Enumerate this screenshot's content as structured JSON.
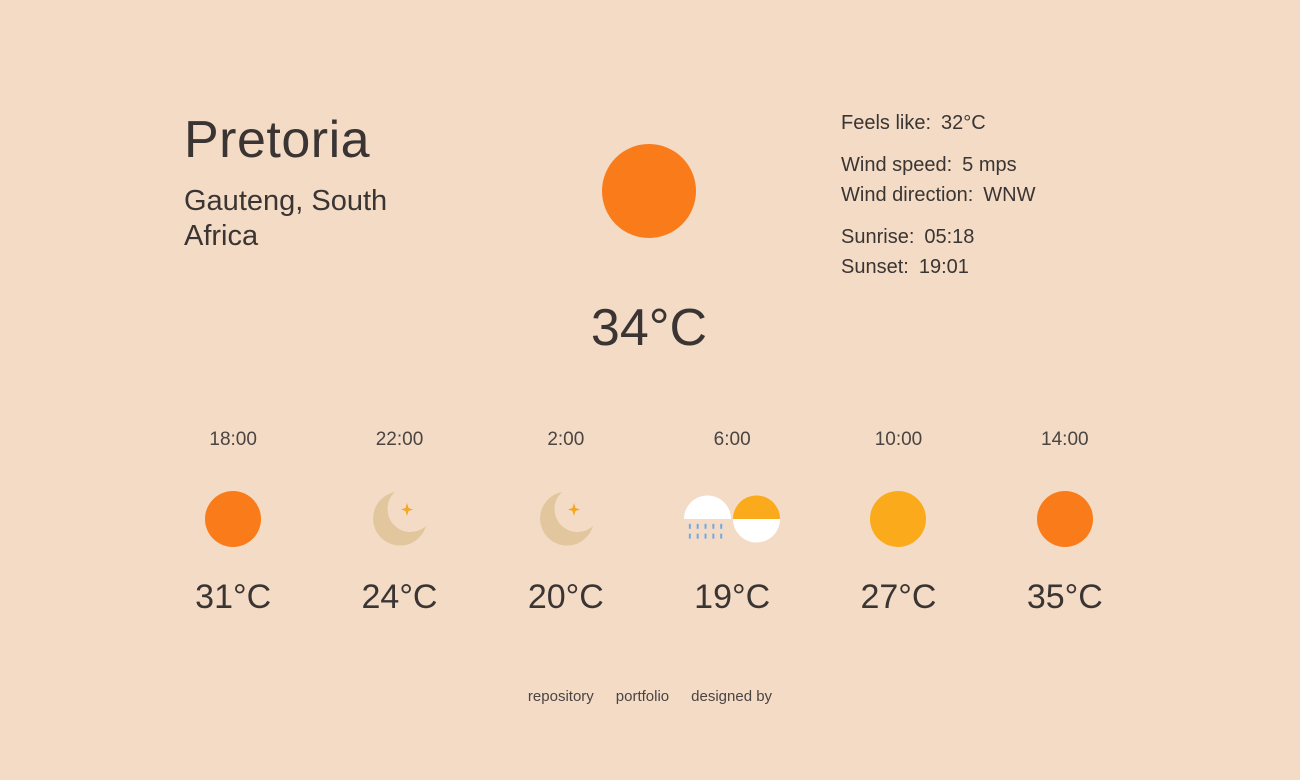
{
  "location": {
    "city": "Pretoria",
    "region": "Gauteng, South Africa"
  },
  "current": {
    "temperature": "34°C",
    "icon": "sun-icon",
    "icon_color": "#f97b1a"
  },
  "details": {
    "feels_like": {
      "label": "Feels like:",
      "value": "32°C"
    },
    "wind_speed": {
      "label": "Wind speed:",
      "value": "5 mps"
    },
    "wind_direction": {
      "label": "Wind direction:",
      "value": "WNW"
    },
    "sunrise": {
      "label": "Sunrise:",
      "value": "05:18"
    },
    "sunset": {
      "label": "Sunset:",
      "value": "19:01"
    }
  },
  "forecast": [
    {
      "time": "18:00",
      "icon": "sun-icon",
      "temperature": "31°C"
    },
    {
      "time": "22:00",
      "icon": "moon-icon",
      "temperature": "24°C"
    },
    {
      "time": "2:00",
      "icon": "moon-icon",
      "temperature": "20°C"
    },
    {
      "time": "6:00",
      "icon": "rain-sun-icon",
      "temperature": "19°C"
    },
    {
      "time": "10:00",
      "icon": "sun-icon",
      "temperature": "27°C"
    },
    {
      "time": "14:00",
      "icon": "sun-icon",
      "temperature": "35°C"
    }
  ],
  "footer": {
    "links": [
      "repository",
      "portfolio",
      "designed by"
    ]
  },
  "colors": {
    "background": "#f3dbc6",
    "sun_hot": "#f97b1a",
    "sun_warm": "#fbaa1b",
    "moon": "#e2c69e",
    "star": "#f5a623",
    "rain": "#6ea8e0",
    "cloud": "#ffffff"
  }
}
